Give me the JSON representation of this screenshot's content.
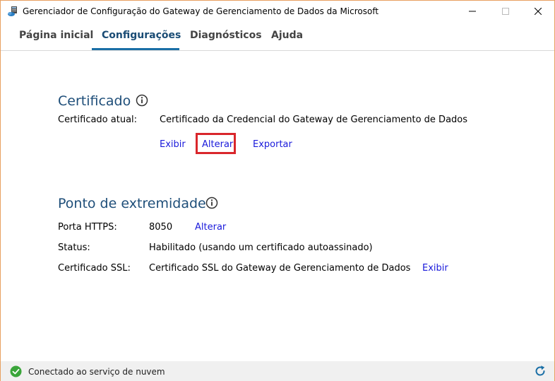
{
  "window": {
    "title": "Gerenciador de Configuração do Gateway de Gerenciamento de Dados da Microsoft",
    "icon": "gateway-app-icon",
    "controls": [
      "minimize-icon",
      "maximize-icon",
      "close-icon"
    ]
  },
  "tabs": [
    {
      "label": "Página inicial",
      "active": false
    },
    {
      "label": "Configurações",
      "active": true
    },
    {
      "label": "Diagnósticos",
      "active": false
    },
    {
      "label": "Ajuda",
      "active": false
    }
  ],
  "certificate": {
    "title": "Certificado",
    "info_icon": "info-icon",
    "current_label": "Certificado atual:",
    "current_value": "Certificado da Credencial do Gateway de Gerenciamento de Dados",
    "actions": {
      "view": "Exibir",
      "change": "Alterar",
      "export": "Exportar"
    }
  },
  "endpoint": {
    "title": "Ponto de extremidade",
    "info_icon": "info-icon",
    "https_port_label": "Porta HTTPS:",
    "https_port_value": "8050",
    "https_port_action": "Alterar",
    "status_label": "Status:",
    "status_value": "Habilitado (usando um certificado autoassinado)",
    "ssl_label": "Certificado SSL:",
    "ssl_value": "Certificado SSL do Gateway de Gerenciamento de Dados",
    "ssl_action": "Exibir"
  },
  "statusbar": {
    "text": "Conectado ao serviço de nuvem",
    "icon": "check-circle-icon",
    "refresh_icon": "refresh-icon"
  },
  "colors": {
    "accent": "#1a6fa6",
    "section_title": "#1e4e79",
    "link": "#1a1adb",
    "highlight": "#d9262b",
    "status_ok": "#3aa53a"
  }
}
